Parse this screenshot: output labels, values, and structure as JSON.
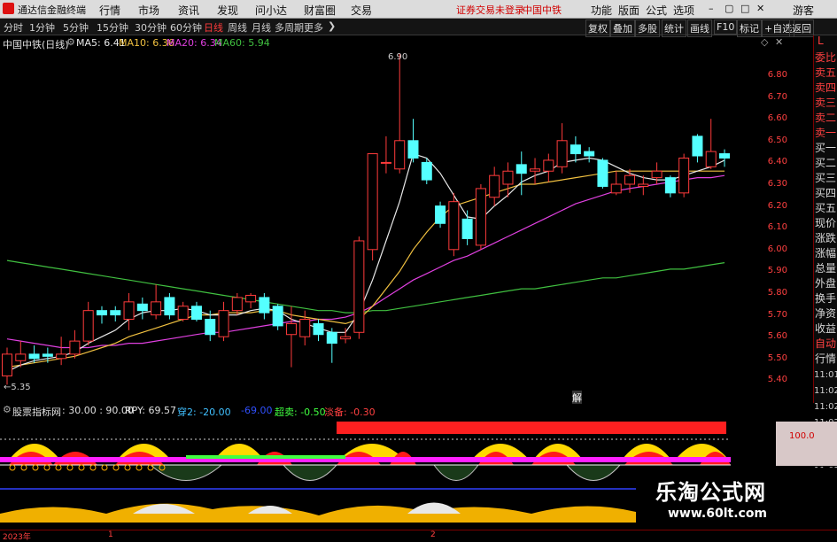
{
  "menubar": {
    "app_title": "通达信金融终端",
    "menus": [
      "行情",
      "市场",
      "资讯",
      "发现",
      "问小达",
      "财富圈",
      "交易"
    ],
    "login_status": "证券交易未登录",
    "stock_label": "中国中铁",
    "right_menus": [
      "功能",
      "版面",
      "公式",
      "选项"
    ],
    "guest": "游客"
  },
  "periods": {
    "items": [
      "分时",
      "1分钟",
      "5分钟",
      "15分钟",
      "30分钟",
      "60分钟",
      "日线",
      "周线",
      "月线",
      "多周期",
      "更多"
    ],
    "active": "日线"
  },
  "toolbar_right": [
    "复权",
    "叠加",
    "多股",
    "统计",
    "画线",
    "F10",
    "标记",
    "+自选",
    "返回"
  ],
  "chart_info": {
    "title": "中国中铁(日线)",
    "ma5": "MA5: 6.41",
    "ma10": "MA10: 6.36",
    "ma20": "MA20: 6.34",
    "ma60": "MA60: 5.94",
    "high_label": "6.90",
    "low_label": "5.35",
    "marker": "解"
  },
  "colors": {
    "up": "#ff3b3b",
    "down": "#54ffff",
    "ma5": "#e8e8e8",
    "ma10": "#f0c040",
    "ma20": "#e040e0",
    "ma60": "#40c040"
  },
  "chart_data": {
    "type": "candlestick",
    "yaxis_ticks": [
      "6.80",
      "6.70",
      "6.60",
      "6.50",
      "6.40",
      "6.30",
      "6.20",
      "6.10",
      "6.00",
      "5.90",
      "5.80",
      "5.70",
      "5.60",
      "5.50",
      "5.40"
    ],
    "ylim": [
      5.35,
      6.92
    ],
    "candles": [
      {
        "o": 5.42,
        "c": 5.52,
        "h": 5.55,
        "l": 5.38
      },
      {
        "o": 5.49,
        "c": 5.52,
        "h": 5.58,
        "l": 5.46
      },
      {
        "o": 5.52,
        "c": 5.5,
        "h": 5.56,
        "l": 5.48
      },
      {
        "o": 5.52,
        "c": 5.51,
        "h": 5.55,
        "l": 5.48
      },
      {
        "o": 5.5,
        "c": 5.52,
        "h": 5.6,
        "l": 5.47
      },
      {
        "o": 5.52,
        "c": 5.58,
        "h": 5.63,
        "l": 5.5
      },
      {
        "o": 5.58,
        "c": 5.72,
        "h": 5.76,
        "l": 5.56
      },
      {
        "o": 5.72,
        "c": 5.7,
        "h": 5.74,
        "l": 5.66
      },
      {
        "o": 5.72,
        "c": 5.7,
        "h": 5.74,
        "l": 5.67
      },
      {
        "o": 5.68,
        "c": 5.76,
        "h": 5.8,
        "l": 5.63
      },
      {
        "o": 5.75,
        "c": 5.72,
        "h": 5.78,
        "l": 5.68
      },
      {
        "o": 5.7,
        "c": 5.76,
        "h": 5.84,
        "l": 5.68
      },
      {
        "o": 5.78,
        "c": 5.7,
        "h": 5.8,
        "l": 5.68
      },
      {
        "o": 5.68,
        "c": 5.74,
        "h": 5.76,
        "l": 5.67
      },
      {
        "o": 5.74,
        "c": 5.68,
        "h": 5.76,
        "l": 5.67
      },
      {
        "o": 5.68,
        "c": 5.61,
        "h": 5.72,
        "l": 5.58
      },
      {
        "o": 5.6,
        "c": 5.72,
        "h": 5.76,
        "l": 5.58
      },
      {
        "o": 5.72,
        "c": 5.78,
        "h": 5.8,
        "l": 5.7
      },
      {
        "o": 5.76,
        "c": 5.79,
        "h": 5.8,
        "l": 5.73
      },
      {
        "o": 5.78,
        "c": 5.71,
        "h": 5.8,
        "l": 5.68
      },
      {
        "o": 5.74,
        "c": 5.65,
        "h": 5.75,
        "l": 5.63
      },
      {
        "o": 5.61,
        "c": 5.66,
        "h": 5.74,
        "l": 5.46
      },
      {
        "o": 5.6,
        "c": 5.68,
        "h": 5.72,
        "l": 5.56
      },
      {
        "o": 5.66,
        "c": 5.61,
        "h": 5.68,
        "l": 5.58
      },
      {
        "o": 5.62,
        "c": 5.57,
        "h": 5.64,
        "l": 5.48
      },
      {
        "o": 5.59,
        "c": 5.6,
        "h": 5.64,
        "l": 5.57
      },
      {
        "o": 5.62,
        "c": 6.04,
        "h": 6.06,
        "l": 5.59
      },
      {
        "o": 6.0,
        "c": 6.44,
        "h": 6.44,
        "l": 5.95
      },
      {
        "o": 6.4,
        "c": 6.4,
        "h": 6.52,
        "l": 6.35
      },
      {
        "o": 6.37,
        "c": 6.5,
        "h": 6.9,
        "l": 6.35
      },
      {
        "o": 6.5,
        "c": 6.42,
        "h": 6.6,
        "l": 6.4
      },
      {
        "o": 6.4,
        "c": 6.32,
        "h": 6.42,
        "l": 6.3
      },
      {
        "o": 6.2,
        "c": 6.12,
        "h": 6.22,
        "l": 6.1
      },
      {
        "o": 6.0,
        "c": 6.22,
        "h": 6.26,
        "l": 5.97
      },
      {
        "o": 6.14,
        "c": 6.05,
        "h": 6.18,
        "l": 6.02
      },
      {
        "o": 6.02,
        "c": 6.28,
        "h": 6.3,
        "l": 6.0
      },
      {
        "o": 6.24,
        "c": 6.34,
        "h": 6.38,
        "l": 6.2
      },
      {
        "o": 6.3,
        "c": 6.36,
        "h": 6.4,
        "l": 6.24
      },
      {
        "o": 6.39,
        "c": 6.35,
        "h": 6.45,
        "l": 6.25
      },
      {
        "o": 6.36,
        "c": 6.37,
        "h": 6.42,
        "l": 6.3
      },
      {
        "o": 6.36,
        "c": 6.41,
        "h": 6.44,
        "l": 6.31
      },
      {
        "o": 6.38,
        "c": 6.5,
        "h": 6.58,
        "l": 6.35
      },
      {
        "o": 6.48,
        "c": 6.44,
        "h": 6.52,
        "l": 6.4
      },
      {
        "o": 6.45,
        "c": 6.43,
        "h": 6.47,
        "l": 6.4
      },
      {
        "o": 6.41,
        "c": 6.29,
        "h": 6.42,
        "l": 6.28
      },
      {
        "o": 6.26,
        "c": 6.3,
        "h": 6.36,
        "l": 6.25
      },
      {
        "o": 6.3,
        "c": 6.34,
        "h": 6.37,
        "l": 6.26
      },
      {
        "o": 6.29,
        "c": 6.3,
        "h": 6.34,
        "l": 6.25
      },
      {
        "o": 6.33,
        "c": 6.36,
        "h": 6.4,
        "l": 6.3
      },
      {
        "o": 6.33,
        "c": 6.26,
        "h": 6.34,
        "l": 6.24
      },
      {
        "o": 6.26,
        "c": 6.42,
        "h": 6.44,
        "l": 6.24
      },
      {
        "o": 6.52,
        "c": 6.43,
        "h": 6.53,
        "l": 6.4
      },
      {
        "o": 6.38,
        "c": 6.45,
        "h": 6.6,
        "l": 6.37
      },
      {
        "o": 6.44,
        "c": 6.42,
        "h": 6.46,
        "l": 6.38
      }
    ],
    "ma5": [
      5.44,
      5.47,
      5.49,
      5.5,
      5.51,
      5.53,
      5.57,
      5.6,
      5.63,
      5.68,
      5.71,
      5.72,
      5.72,
      5.73,
      5.72,
      5.7,
      5.7,
      5.7,
      5.72,
      5.73,
      5.72,
      5.68,
      5.66,
      5.64,
      5.62,
      5.62,
      5.71,
      5.86,
      6.04,
      6.22,
      6.44,
      6.42,
      6.35,
      6.25,
      6.15,
      6.14,
      6.2,
      6.25,
      6.31,
      6.34,
      6.36,
      6.4,
      6.41,
      6.42,
      6.41,
      6.38,
      6.35,
      6.33,
      6.32,
      6.32,
      6.34,
      6.36,
      6.38,
      6.41
    ],
    "ma10": [
      5.46,
      5.47,
      5.48,
      5.49,
      5.5,
      5.51,
      5.53,
      5.55,
      5.57,
      5.6,
      5.62,
      5.64,
      5.66,
      5.68,
      5.7,
      5.7,
      5.71,
      5.71,
      5.71,
      5.72,
      5.72,
      5.7,
      5.69,
      5.68,
      5.67,
      5.66,
      5.68,
      5.74,
      5.82,
      5.9,
      6.0,
      6.08,
      6.15,
      6.2,
      6.22,
      6.24,
      6.26,
      6.28,
      6.3,
      6.3,
      6.31,
      6.32,
      6.33,
      6.34,
      6.35,
      6.36,
      6.36,
      6.36,
      6.36,
      6.36,
      6.36,
      6.36,
      6.36,
      6.36
    ],
    "ma20": [
      5.59,
      5.58,
      5.57,
      5.56,
      5.55,
      5.55,
      5.55,
      5.56,
      5.56,
      5.57,
      5.57,
      5.58,
      5.59,
      5.6,
      5.61,
      5.62,
      5.62,
      5.63,
      5.64,
      5.65,
      5.66,
      5.67,
      5.67,
      5.68,
      5.68,
      5.69,
      5.71,
      5.74,
      5.78,
      5.82,
      5.86,
      5.89,
      5.92,
      5.95,
      5.97,
      6.0,
      6.03,
      6.06,
      6.09,
      6.12,
      6.15,
      6.18,
      6.21,
      6.23,
      6.25,
      6.27,
      6.28,
      6.29,
      6.3,
      6.31,
      6.32,
      6.33,
      6.33,
      6.34
    ],
    "ma60": [
      5.95,
      5.94,
      5.93,
      5.92,
      5.91,
      5.9,
      5.89,
      5.88,
      5.87,
      5.86,
      5.85,
      5.84,
      5.83,
      5.82,
      5.81,
      5.8,
      5.79,
      5.78,
      5.77,
      5.76,
      5.75,
      5.74,
      5.73,
      5.72,
      5.72,
      5.71,
      5.71,
      5.72,
      5.72,
      5.73,
      5.74,
      5.75,
      5.76,
      5.77,
      5.78,
      5.79,
      5.8,
      5.81,
      5.82,
      5.82,
      5.83,
      5.84,
      5.85,
      5.86,
      5.87,
      5.87,
      5.88,
      5.89,
      5.9,
      5.91,
      5.91,
      5.92,
      5.93,
      5.94
    ]
  },
  "right_panel": {
    "items": [
      "委比",
      "卖五",
      "卖四",
      "卖三",
      "卖二",
      "卖一",
      "买一",
      "买二",
      "买三",
      "买四",
      "买五",
      "现价",
      "涨跌",
      "涨幅",
      "总量",
      "外盘",
      "换手",
      "净资",
      "收益",
      "自动",
      "行情"
    ],
    "times": [
      "11:01",
      "11:02",
      "11:02",
      "11:02",
      "11:02",
      "11:02",
      "11:02",
      "11:02",
      "11:02",
      "11:02"
    ],
    "corner": "L"
  },
  "indicator": {
    "name": "股票指标网",
    "params": ": 30.00 : 90.00",
    "rpy": "RPY: 69.57",
    "chuan": "穿2: -20.00",
    "val_blue": "-69.00",
    "chaomai": "超卖: -0.50",
    "lingyi": "淡备: -0.30",
    "scale": "100.0"
  },
  "watermark": {
    "title": "乐淘公式网",
    "url": "www.60lt.com"
  },
  "datebar": {
    "year": "2023年",
    "m1": "1",
    "m2": "2"
  }
}
